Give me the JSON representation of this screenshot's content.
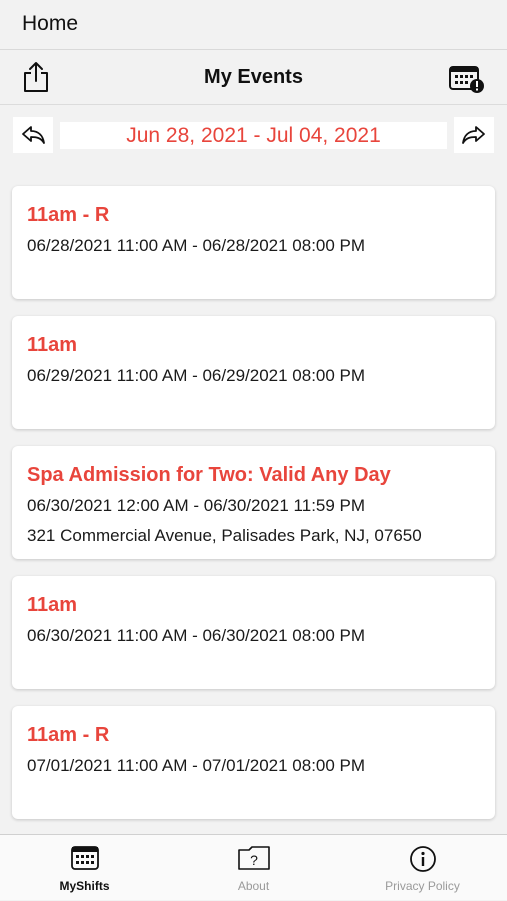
{
  "top": {
    "home_label": "Home"
  },
  "nav": {
    "title": "My Events"
  },
  "date_nav": {
    "range": "Jun 28, 2021 - Jul 04, 2021"
  },
  "events": [
    {
      "title": "11am - R",
      "time": "06/28/2021 11:00 AM - 06/28/2021 08:00 PM"
    },
    {
      "title": "11am",
      "time": "06/29/2021 11:00 AM - 06/29/2021 08:00 PM"
    },
    {
      "title": "Spa Admission for Two: Valid Any Day",
      "time": "06/30/2021 12:00 AM - 06/30/2021 11:59 PM",
      "location": "321 Commercial Avenue, Palisades Park, NJ, 07650"
    },
    {
      "title": "11am",
      "time": "06/30/2021 11:00 AM - 06/30/2021 08:00 PM"
    },
    {
      "title": "11am - R",
      "time": "07/01/2021 11:00 AM - 07/01/2021 08:00 PM"
    }
  ],
  "tabs": [
    {
      "label": "MyShifts",
      "icon": "calendar-icon",
      "active": true
    },
    {
      "label": "About",
      "icon": "question-icon",
      "active": false
    },
    {
      "label": "Privacy Policy",
      "icon": "info-icon",
      "active": false
    }
  ],
  "colors": {
    "accent": "#e8453c",
    "background": "#f2f2f2",
    "card": "#ffffff"
  }
}
